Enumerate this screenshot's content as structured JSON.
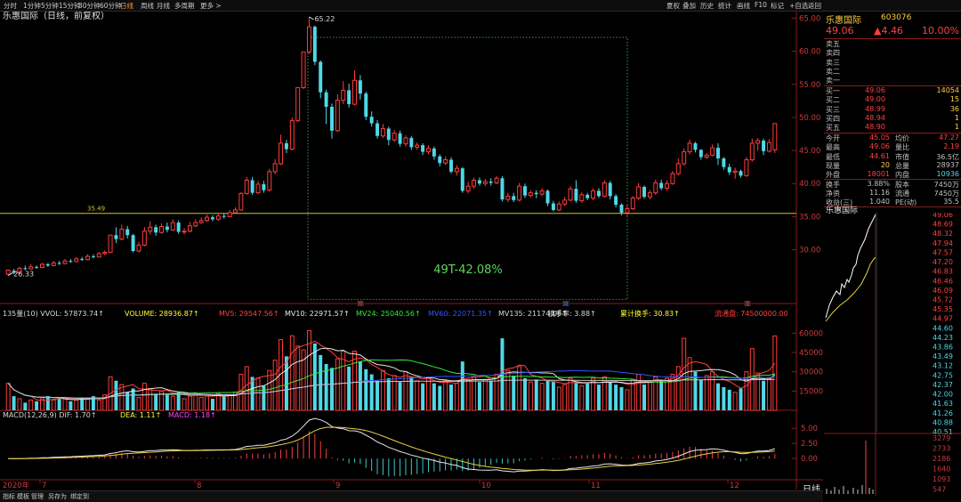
{
  "toolbar": {
    "periods": [
      "分时",
      "1分钟",
      "5分钟",
      "15分钟",
      "30分钟",
      "60分钟",
      "日线",
      "周线",
      "月线",
      "多周期",
      "更多 >"
    ],
    "active_period": "日线",
    "right_buttons": [
      "夏权",
      "叠加",
      "历史",
      "统计",
      "画线",
      "F10",
      "标记",
      "+自选",
      "返回"
    ]
  },
  "chart_header": {
    "name": "乐惠国际（日线，前复权）"
  },
  "price_axis": {
    "ticks": [
      "65.00",
      "60.00",
      "55.00",
      "50.00",
      "45.00",
      "40.00",
      "35.00",
      "30.00"
    ]
  },
  "annotations": {
    "high_label": "65.22",
    "low_label": "26.33",
    "level_label": "35.49",
    "range_label": "49T-42.08%"
  },
  "volume_header": {
    "items": [
      {
        "text": "135量(10) VVOL: 57873.74↑",
        "color": "#d8d8d8"
      },
      {
        "text": "VOLUME: 28936.87↑",
        "color": "#ffff33"
      },
      {
        "text": "MV5: 29547.56↑",
        "color": "#ff4040"
      },
      {
        "text": "MV10: 22971.57↑",
        "color": "#e8e8e8"
      },
      {
        "text": "MV24: 25040.56↑",
        "color": "#33ee33"
      },
      {
        "text": "MV60: 22071.35↑",
        "color": "#3355ff"
      },
      {
        "text": "MV135: 21174.06↑",
        "color": "#d8d8d8"
      },
      {
        "text": "换手率: 3.88↑",
        "color": "#d8d8d8"
      },
      {
        "text": "累计换手: 30.83↑",
        "color": "#ffff33"
      },
      {
        "text": "流通盘: 74500000.00",
        "color": "#ff4040"
      }
    ]
  },
  "volume_axis": {
    "ticks": [
      "60000",
      "45000",
      "30000",
      "15000"
    ]
  },
  "macd_header": {
    "items": [
      {
        "text": "MACD(12,26,9) DIF: 1.70↑",
        "color": "#d8d8d8"
      },
      {
        "text": "DEA: 1.11↑",
        "color": "#ffff33"
      },
      {
        "text": "MACD: 1.18↑",
        "color": "#ff44ff"
      }
    ]
  },
  "macd_axis": {
    "ticks": [
      "5.00",
      "2.50",
      "0.00"
    ]
  },
  "event_markers": [
    "预",
    "财",
    "涨"
  ],
  "time_axis": {
    "labels": [
      "2020年",
      "7",
      "8",
      "9",
      "10",
      "11",
      "12"
    ]
  },
  "side_panel": {
    "title": "乐惠国际",
    "code": "603076",
    "last": "49.06",
    "change": "▲4.46",
    "pct": "10.00%",
    "asks": [
      {
        "label": "卖五",
        "price": "",
        "vol": ""
      },
      {
        "label": "卖四",
        "price": "",
        "vol": ""
      },
      {
        "label": "卖三",
        "price": "",
        "vol": ""
      },
      {
        "label": "卖二",
        "price": "",
        "vol": ""
      },
      {
        "label": "卖一",
        "price": "",
        "vol": ""
      }
    ],
    "bids": [
      {
        "label": "买一",
        "price": "49.06",
        "vol": "14054"
      },
      {
        "label": "买二",
        "price": "49.00",
        "vol": "15"
      },
      {
        "label": "买三",
        "price": "48.99",
        "vol": "36"
      },
      {
        "label": "买四",
        "price": "48.94",
        "vol": "1"
      },
      {
        "label": "买五",
        "price": "48.90",
        "vol": "1"
      }
    ],
    "stats": [
      {
        "l1": "今开",
        "v1": "45.05",
        "l2": "均价",
        "v2": "47.27"
      },
      {
        "l1": "最高",
        "v1": "49.06",
        "l2": "量比",
        "v2": "2.19"
      },
      {
        "l1": "最低",
        "v1": "44.61",
        "l2": "市值",
        "v2": "36.5亿"
      },
      {
        "l1": "现量",
        "v1": "20",
        "l2": "总量",
        "v2": "28937"
      },
      {
        "l1": "外盘",
        "v1": "18001",
        "l2": "内盘",
        "v2": "10936"
      },
      {
        "l1": "换手",
        "v1": "3.88%",
        "l2": "股本",
        "v2": "7450万"
      },
      {
        "l1": "净资",
        "v1": "11.16",
        "l2": "流通",
        "v2": "7450万"
      },
      {
        "l1": "收益(三)",
        "v1": "1.040",
        "l2": "PE(动)",
        "v2": "35.5"
      }
    ],
    "mini_title": "乐惠国际",
    "mini_price_ticks": [
      "49.06",
      "48.69",
      "48.32",
      "47.94",
      "47.57",
      "47.20",
      "46.83",
      "46.46",
      "46.09",
      "45.72",
      "45.35",
      "44.97",
      "44.60",
      "44.23",
      "43.86",
      "43.49",
      "43.12",
      "42.75",
      "42.37",
      "42.00",
      "41.63",
      "41.26",
      "40.88",
      "40.51"
    ],
    "mini_volume_ticks": [
      "3279",
      "2733",
      "2186",
      "1640",
      "1093",
      "547"
    ],
    "bottom_tab": "日线"
  },
  "bottom_tabs": [
    "指标",
    "模板",
    "管理",
    "另存为",
    "绑定到"
  ],
  "chart_data": {
    "type": "candlestick",
    "title": "乐惠国际（日线，前复权）",
    "ylim": [
      22,
      66
    ],
    "x_months": [
      "7",
      "8",
      "9",
      "10",
      "11",
      "12"
    ],
    "candles": [
      [
        26.3,
        26.9,
        26.1,
        27.0
      ],
      [
        26.8,
        26.5,
        26.3,
        27.1
      ],
      [
        26.5,
        27.2,
        26.3,
        27.4
      ],
      [
        27.2,
        27.1,
        26.9,
        27.6
      ],
      [
        27.1,
        27.4,
        27.0,
        27.8
      ],
      [
        27.4,
        27.3,
        27.1,
        27.6
      ],
      [
        27.3,
        27.8,
        27.2,
        28.0
      ],
      [
        27.8,
        27.6,
        27.4,
        28.0
      ],
      [
        27.6,
        28.0,
        27.5,
        28.3
      ],
      [
        28.0,
        27.9,
        27.7,
        28.3
      ],
      [
        27.9,
        28.3,
        27.8,
        28.6
      ],
      [
        28.3,
        28.2,
        28.0,
        28.6
      ],
      [
        28.2,
        28.6,
        28.1,
        28.9
      ],
      [
        28.6,
        28.5,
        28.3,
        28.9
      ],
      [
        28.5,
        29.0,
        28.4,
        29.3
      ],
      [
        29.0,
        28.9,
        28.7,
        29.3
      ],
      [
        28.9,
        29.4,
        28.8,
        29.7
      ],
      [
        29.4,
        29.6,
        29.2,
        29.9
      ],
      [
        29.6,
        32.2,
        29.6,
        32.2
      ],
      [
        32.2,
        31.6,
        31.0,
        33.4
      ],
      [
        31.6,
        33.1,
        31.4,
        33.8
      ],
      [
        33.1,
        32.2,
        31.7,
        33.6
      ],
      [
        32.2,
        29.8,
        29.6,
        32.4
      ],
      [
        29.8,
        30.7,
        29.6,
        31.2
      ],
      [
        30.7,
        32.8,
        30.5,
        33.4
      ],
      [
        32.8,
        33.4,
        32.3,
        34.3
      ],
      [
        33.4,
        32.6,
        32.1,
        33.8
      ],
      [
        32.6,
        33.5,
        32.4,
        34.0
      ],
      [
        33.5,
        33.0,
        32.6,
        34.1
      ],
      [
        33.0,
        34.1,
        32.8,
        34.6
      ],
      [
        34.1,
        32.7,
        32.4,
        34.4
      ],
      [
        32.7,
        32.8,
        32.3,
        33.3
      ],
      [
        32.8,
        33.6,
        32.6,
        34.2
      ],
      [
        33.6,
        34.1,
        33.4,
        34.6
      ],
      [
        34.1,
        34.4,
        33.9,
        34.9
      ],
      [
        34.4,
        34.9,
        34.2,
        35.3
      ],
      [
        34.9,
        34.6,
        34.3,
        35.2
      ],
      [
        34.6,
        35.1,
        34.4,
        35.6
      ],
      [
        35.1,
        35.0,
        34.7,
        35.5
      ],
      [
        35.0,
        35.6,
        34.9,
        36.0
      ],
      [
        35.6,
        36.0,
        35.4,
        36.4
      ],
      [
        36.0,
        38.5,
        35.9,
        38.7
      ],
      [
        38.5,
        40.5,
        38.3,
        41.0
      ],
      [
        40.5,
        38.6,
        38.3,
        41.0
      ],
      [
        38.6,
        39.9,
        38.4,
        40.4
      ],
      [
        39.9,
        39.0,
        38.6,
        40.4
      ],
      [
        39.0,
        41.8,
        38.8,
        42.2
      ],
      [
        41.8,
        43.0,
        41.4,
        43.7
      ],
      [
        43.0,
        46.1,
        42.8,
        47.4
      ],
      [
        46.1,
        45.2,
        44.6,
        46.6
      ],
      [
        45.2,
        49.5,
        45.0,
        50.0
      ],
      [
        49.5,
        54.5,
        49.3,
        54.5
      ],
      [
        54.5,
        59.9,
        54.3,
        59.9
      ],
      [
        59.9,
        63.7,
        59.6,
        65.2
      ],
      [
        63.7,
        58.4,
        57.9,
        63.9
      ],
      [
        58.4,
        53.8,
        52.9,
        58.6
      ],
      [
        53.8,
        51.6,
        49.0,
        54.2
      ],
      [
        51.6,
        48.0,
        46.8,
        52.1
      ],
      [
        48.0,
        52.6,
        47.8,
        53.5
      ],
      [
        52.6,
        54.1,
        52.0,
        55.5
      ],
      [
        54.1,
        52.0,
        51.5,
        55.1
      ],
      [
        52.0,
        55.6,
        51.8,
        57.1
      ],
      [
        55.6,
        53.6,
        52.7,
        56.4
      ],
      [
        53.6,
        50.1,
        49.6,
        53.9
      ],
      [
        50.1,
        49.1,
        48.6,
        50.9
      ],
      [
        49.1,
        47.2,
        46.8,
        49.6
      ],
      [
        47.2,
        48.3,
        46.9,
        49.0
      ],
      [
        48.3,
        46.6,
        45.8,
        48.6
      ],
      [
        46.6,
        47.6,
        46.3,
        48.1
      ],
      [
        47.6,
        46.0,
        45.6,
        48.0
      ],
      [
        46.0,
        46.9,
        45.6,
        47.3
      ],
      [
        46.9,
        45.5,
        45.1,
        47.2
      ],
      [
        45.5,
        45.8,
        45.1,
        46.2
      ],
      [
        45.8,
        44.8,
        44.3,
        46.1
      ],
      [
        44.8,
        45.3,
        44.4,
        45.8
      ],
      [
        45.3,
        44.1,
        43.6,
        45.6
      ],
      [
        44.1,
        43.1,
        42.6,
        44.4
      ],
      [
        43.1,
        43.6,
        42.8,
        44.1
      ],
      [
        43.6,
        41.8,
        41.5,
        44.0
      ],
      [
        41.8,
        42.3,
        41.2,
        42.8
      ],
      [
        42.3,
        38.9,
        38.6,
        42.5
      ],
      [
        38.9,
        39.6,
        38.5,
        40.3
      ],
      [
        39.6,
        40.5,
        39.2,
        40.9
      ],
      [
        40.5,
        40.0,
        39.7,
        40.9
      ],
      [
        40.0,
        40.3,
        39.6,
        40.7
      ],
      [
        40.3,
        40.1,
        39.7,
        40.8
      ],
      [
        40.1,
        40.8,
        39.9,
        41.1
      ],
      [
        40.8,
        37.6,
        37.3,
        41.1
      ],
      [
        37.6,
        38.1,
        37.2,
        38.6
      ],
      [
        38.1,
        37.5,
        37.2,
        38.6
      ],
      [
        37.5,
        39.6,
        37.3,
        40.1
      ],
      [
        39.6,
        38.2,
        37.8,
        40.0
      ],
      [
        38.2,
        38.6,
        37.9,
        39.0
      ],
      [
        38.6,
        38.4,
        37.8,
        39.0
      ],
      [
        38.4,
        38.9,
        38.1,
        39.3
      ],
      [
        38.9,
        37.0,
        36.6,
        39.1
      ],
      [
        37.0,
        36.0,
        35.8,
        37.4
      ],
      [
        36.0,
        36.9,
        35.8,
        37.3
      ],
      [
        36.9,
        37.5,
        36.6,
        38.0
      ],
      [
        37.5,
        39.2,
        37.3,
        39.6
      ],
      [
        39.2,
        37.4,
        37.1,
        40.5
      ],
      [
        37.4,
        38.3,
        37.1,
        38.7
      ],
      [
        38.3,
        37.8,
        37.5,
        38.6
      ],
      [
        37.8,
        38.9,
        37.5,
        39.3
      ],
      [
        38.9,
        38.1,
        37.8,
        39.3
      ],
      [
        38.1,
        40.1,
        37.9,
        40.5
      ],
      [
        40.1,
        38.1,
        37.6,
        40.4
      ],
      [
        38.1,
        36.8,
        36.4,
        38.4
      ],
      [
        36.8,
        35.6,
        35.2,
        37.0
      ],
      [
        35.6,
        36.2,
        35.1,
        36.8
      ],
      [
        36.2,
        37.8,
        36.0,
        38.1
      ],
      [
        37.8,
        39.5,
        37.5,
        40.1
      ],
      [
        39.5,
        38.0,
        37.7,
        39.7
      ],
      [
        38.0,
        38.6,
        37.6,
        39.0
      ],
      [
        38.6,
        40.1,
        38.3,
        40.6
      ],
      [
        40.1,
        39.3,
        39.0,
        40.6
      ],
      [
        39.3,
        40.0,
        38.9,
        40.5
      ],
      [
        40.0,
        41.5,
        39.8,
        41.9
      ],
      [
        41.5,
        43.0,
        41.2,
        43.8
      ],
      [
        43.0,
        44.8,
        42.7,
        45.3
      ],
      [
        44.8,
        46.1,
        44.4,
        46.6
      ],
      [
        46.1,
        45.1,
        44.7,
        46.3
      ],
      [
        45.1,
        44.0,
        43.6,
        45.2
      ],
      [
        44.0,
        44.3,
        43.7,
        44.6
      ],
      [
        44.3,
        45.4,
        44.1,
        45.9
      ],
      [
        45.4,
        43.8,
        42.8,
        46.1
      ],
      [
        43.8,
        42.5,
        42.1,
        44.0
      ],
      [
        42.5,
        41.7,
        41.3,
        43.0
      ],
      [
        41.7,
        41.9,
        40.7,
        42.4
      ],
      [
        41.9,
        41.2,
        40.9,
        42.1
      ],
      [
        41.2,
        43.6,
        41.0,
        44.0
      ],
      [
        43.6,
        46.1,
        43.3,
        46.8
      ],
      [
        46.1,
        46.5,
        45.0,
        46.9
      ],
      [
        46.5,
        44.9,
        44.3,
        46.8
      ],
      [
        44.9,
        46.2,
        44.7,
        46.7
      ],
      [
        45.1,
        49.06,
        44.61,
        49.06
      ]
    ],
    "vol_ylim": [
      0,
      72000
    ],
    "volumes": [
      21000,
      11000,
      9000,
      6000,
      8000,
      7000,
      9000,
      11000,
      8000,
      10000,
      9000,
      7000,
      8000,
      10000,
      9000,
      11000,
      8000,
      12000,
      26000,
      23000,
      20000,
      14000,
      17000,
      10000,
      21000,
      17000,
      13000,
      15000,
      12000,
      11000,
      14000,
      9000,
      11000,
      13000,
      10000,
      12000,
      9000,
      13000,
      11000,
      12000,
      14000,
      28000,
      34000,
      26000,
      25000,
      19000,
      31000,
      39000,
      55000,
      42000,
      58000,
      50000,
      47000,
      62000,
      52000,
      43000,
      36000,
      33000,
      40000,
      46000,
      34000,
      46000,
      38000,
      32000,
      28000,
      23000,
      31000,
      25000,
      27000,
      22000,
      30000,
      26000,
      23000,
      21000,
      25000,
      21000,
      19000,
      23000,
      20000,
      21000,
      38000,
      24000,
      26000,
      22000,
      24000,
      23000,
      28000,
      56000,
      31000,
      27000,
      34000,
      25000,
      22000,
      24000,
      21000,
      23000,
      22000,
      18000,
      20000,
      25000,
      22000,
      19000,
      21000,
      25000,
      20000,
      26000,
      22000,
      20000,
      18000,
      16000,
      24000,
      28000,
      20000,
      22000,
      26000,
      23000,
      25000,
      28000,
      34000,
      56000,
      41000,
      30000,
      24000,
      27000,
      30000,
      21000,
      18000,
      16000,
      14000,
      17000,
      30000,
      48000,
      29000,
      23000,
      25000,
      57873
    ],
    "volume_series_colors": {
      "MV5": "#ff4040",
      "MV10": "#e8e8e8",
      "MV24": "#33ee33",
      "MV60": "#3355ff",
      "MV135": "#d8d8d8"
    },
    "macd_ylim": [
      -3.5,
      6.5
    ]
  }
}
